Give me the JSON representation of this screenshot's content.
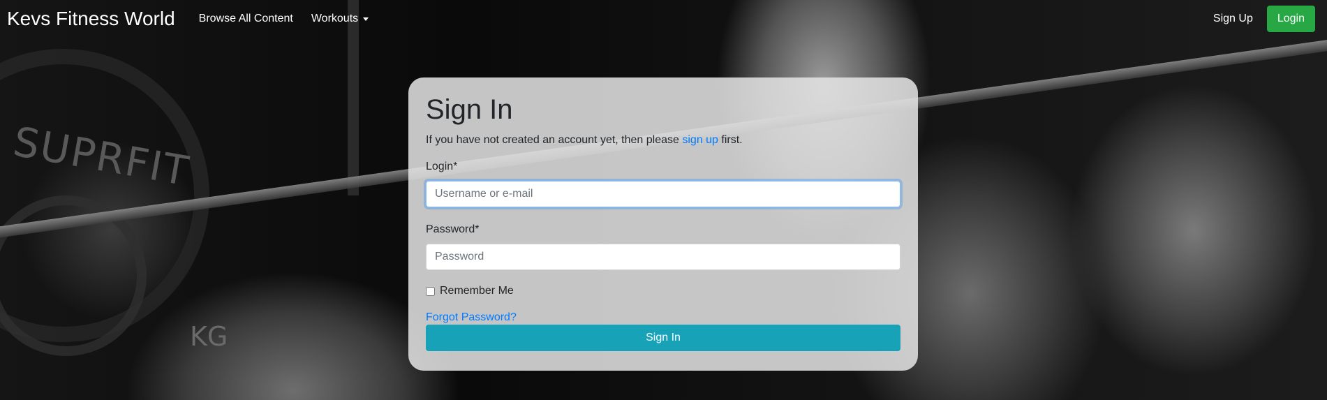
{
  "navbar": {
    "brand": "Kevs Fitness World",
    "links": [
      {
        "label": "Browse All Content"
      },
      {
        "label": "Workouts"
      }
    ],
    "sign_up": "Sign Up",
    "login": "Login"
  },
  "background": {
    "plate_text": "SUPRFIT",
    "plate_weight_text": "KG"
  },
  "signin": {
    "title": "Sign In",
    "intro_before": "If you have not created an account yet, then please ",
    "intro_link": "sign up",
    "intro_after": " first.",
    "login_label": "Login*",
    "login_placeholder": "Username or e-mail",
    "password_label": "Password*",
    "password_placeholder": "Password",
    "remember_label": "Remember Me",
    "forgot_label": "Forgot Password?",
    "submit_label": "Sign In"
  },
  "colors": {
    "login_button": "#28a745",
    "signin_button": "#17a2b8",
    "link": "#007bff"
  }
}
